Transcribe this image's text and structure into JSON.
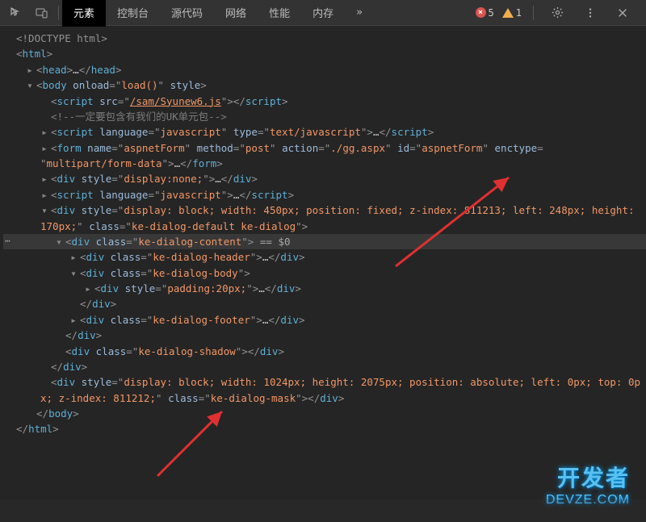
{
  "toolbar": {
    "tabs": [
      "元素",
      "控制台",
      "源代码",
      "网络",
      "性能",
      "内存"
    ],
    "more": "»",
    "errors_count": "5",
    "warnings_count": "1"
  },
  "dom": {
    "doctype": "<!DOCTYPE html>",
    "html_open": "html",
    "head_open": "head",
    "head_ellipsis": "…",
    "head_close": "head",
    "body_open_tag": "body",
    "body_onload_attr": "onload",
    "body_onload_val": "load()",
    "body_style_attr": "style",
    "script1_tag": "script",
    "script1_src_attr": "src",
    "script1_src_val": "/sam/Syunew6.js",
    "comment": "一定要包含有我们的UK单元包",
    "script2_tag": "script",
    "script2_lang_attr": "language",
    "script2_lang_val": "javascript",
    "script2_type_attr": "type",
    "script2_type_val": "text/javascript",
    "form_tag": "form",
    "form_name_attr": "name",
    "form_name_val": "aspnetForm",
    "form_method_attr": "method",
    "form_method_val": "post",
    "form_action_attr": "action",
    "form_action_val": "./gg.aspx",
    "form_id_attr": "id",
    "form_id_val": "aspnetForm",
    "form_enctype_attr": "enctype",
    "form_enctype_val": "multipart/form-data",
    "div_hidden_tag": "div",
    "div_hidden_style_val": "display:none;",
    "script3_tag": "script",
    "dialog_div_tag": "div",
    "dialog_style_val": "display: block; width: 450px; position: fixed; z-index: 811213; left: 248px; height: 170px;",
    "dialog_class_val": "ke-dialog-default ke-dialog",
    "dialog_content_class": "ke-dialog-content",
    "selected_marker": " == $0",
    "dialog_header_class": "ke-dialog-header",
    "dialog_body_class": "ke-dialog-body",
    "dialog_body_inner_style": "padding:20px;",
    "dialog_footer_class": "ke-dialog-footer",
    "dialog_shadow_class": "ke-dialog-shadow",
    "mask_style_val": "display: block; width: 1024px; height: 2075px; position: absolute; left: 0px; top: 0px; z-index: 811212;",
    "mask_class_val": "ke-dialog-mask",
    "style_attr_name": "style",
    "class_attr_name": "class",
    "div_tag": "div"
  },
  "watermark": {
    "line1": "开发者",
    "line2": "DEVZE.COM"
  }
}
